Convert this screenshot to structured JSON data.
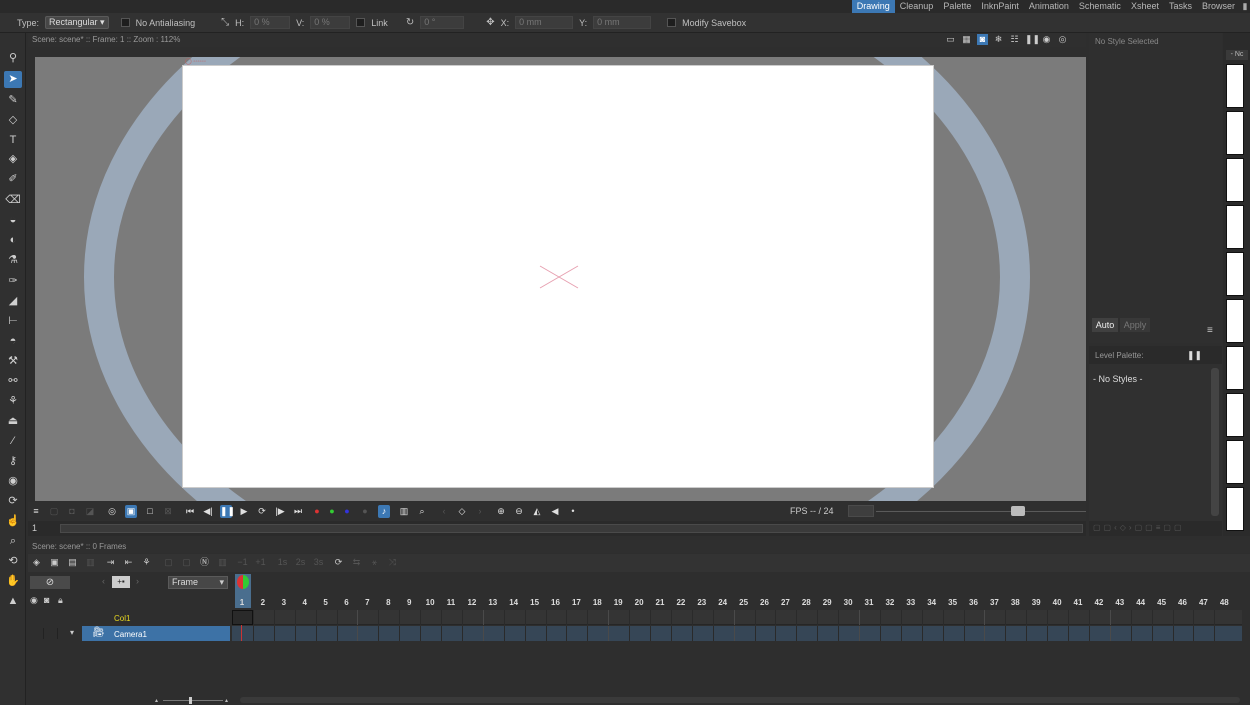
{
  "rooms": {
    "items": [
      "Drawing",
      "Cleanup",
      "Palette",
      "InknPaint",
      "Animation",
      "Schematic",
      "Xsheet",
      "Tasks",
      "Browser"
    ],
    "active": "Drawing"
  },
  "tool_options": {
    "type_label": "Type:",
    "type_value": "Rectangular",
    "antialias_label": "No Antialiasing",
    "h_label": "H:",
    "h_value": "0 %",
    "v_label": "V:",
    "v_value": "0 %",
    "link_label": "Link",
    "rotation_value": "0 °",
    "x_label": "X:",
    "x_value": "0 mm",
    "y_label": "Y:",
    "y_value": "0 mm",
    "savebox_label": "Modify Savebox"
  },
  "viewer": {
    "title": "Scene: scene*  ::  Frame: 1  ::  Zoom : 112%",
    "fps_label": "FPS -- / 24",
    "frame_value": "1"
  },
  "style_editor": {
    "title": "No Style Selected",
    "auto_label": "Auto",
    "apply_label": "Apply"
  },
  "level_palette": {
    "title": "Level Palette:",
    "empty_text": "- No Styles -"
  },
  "right_strip": {
    "header": "- Nc"
  },
  "xsheet": {
    "title": "Scene: scene*  ::  0 Frames",
    "frame_combo": "Frame",
    "col1_name": "Col1",
    "camera_name": "Camera1",
    "frames": [
      "1",
      "2",
      "3",
      "4",
      "5",
      "6",
      "7",
      "8",
      "9",
      "10",
      "11",
      "12",
      "13",
      "14",
      "15",
      "16",
      "17",
      "18",
      "19",
      "20",
      "21",
      "22",
      "23",
      "24",
      "25",
      "26",
      "27",
      "28",
      "29",
      "30",
      "31",
      "32",
      "33",
      "34",
      "35",
      "36",
      "37",
      "38",
      "39",
      "40",
      "41",
      "42",
      "43",
      "44",
      "45",
      "46",
      "47",
      "48"
    ]
  },
  "colors": {
    "accent": "#3c78b4",
    "camera_ring": "#9aa8b8",
    "column_name": "#e8d820"
  }
}
